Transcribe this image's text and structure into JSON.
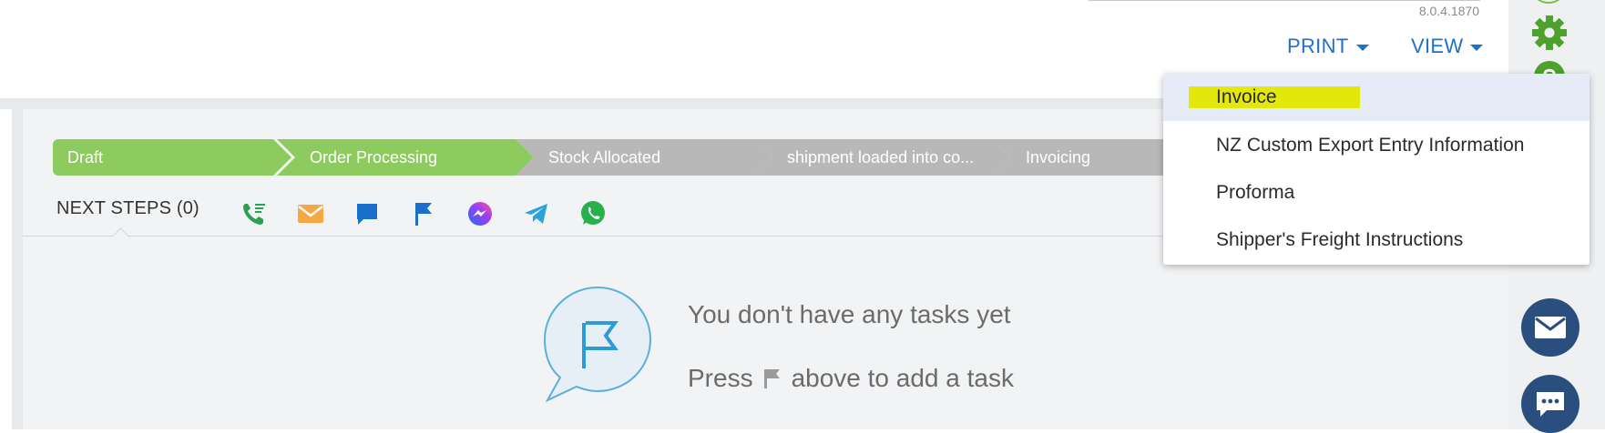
{
  "header": {
    "version": "8.0.4.1870",
    "print_label": "PRINT",
    "view_label": "VIEW"
  },
  "stages": [
    {
      "label": "Draft",
      "status": "done"
    },
    {
      "label": "Order Processing",
      "status": "done"
    },
    {
      "label": "Stock Allocated",
      "status": "todo"
    },
    {
      "label": "shipment loaded into co...",
      "status": "todo"
    },
    {
      "label": "Invoicing",
      "status": "todo"
    }
  ],
  "next_steps": {
    "label": "NEXT STEPS (0)",
    "actions": [
      "phone-list-icon",
      "email-icon",
      "comment-icon",
      "flag-icon",
      "messenger-icon",
      "telegram-icon",
      "whatsapp-icon"
    ]
  },
  "empty_state": {
    "line1": "You don't have any tasks yet",
    "line2_before": "Press",
    "line2_after": "above to add a task"
  },
  "print_dropdown": {
    "items": [
      "Invoice",
      "NZ Custom Export Entry Information",
      "Proforma",
      "Shipper's Freight Instructions"
    ],
    "active_index": 0
  },
  "colors": {
    "accent": "#1f6fd0",
    "stage_done": "#8ecb5e",
    "stage_todo": "#b8b8b8",
    "rail_button": "#2a4e7d",
    "highlight": "#e4e80a"
  }
}
